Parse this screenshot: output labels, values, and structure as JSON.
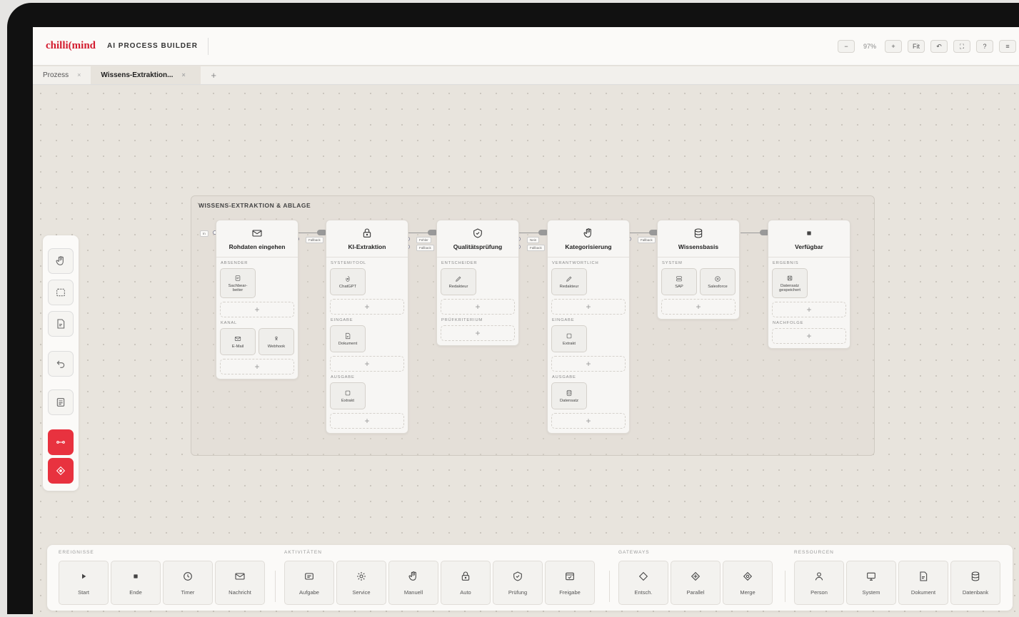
{
  "app": {
    "logo": "chilli(mind",
    "title": "AI PROCESS BUILDER"
  },
  "toolbar": {
    "zoom_out": "−",
    "zoom_level": "97%",
    "zoom_in": "+",
    "fit": "Fit",
    "undo": "↶",
    "fullscreen": "⛶",
    "help": "?",
    "menu": "≡"
  },
  "tabs": [
    {
      "label": "Prozess",
      "close": "×"
    },
    {
      "label": "Wissens-Extraktion...",
      "close": "×"
    }
  ],
  "tab_add": "+",
  "group": {
    "title": "WISSENS-EXTRAKTION & ABLAGE"
  },
  "nodes": [
    {
      "title": "Rohdaten eingehen",
      "icon": "mail-icon",
      "sections": [
        {
          "label": "ABSENDER",
          "chips": [
            {
              "label": "Sachbear-\nbeiter",
              "icon": "form-icon"
            }
          ]
        },
        {
          "label": "KANAL",
          "chips": [
            {
              "label": "E-Mail",
              "icon": "mail-icon"
            },
            {
              "label": "Webhook",
              "icon": "webhook-icon"
            }
          ]
        }
      ]
    },
    {
      "title": "KI-Extraktion",
      "icon": "robot-lock-icon",
      "sections": [
        {
          "label": "SYSTEM/TOOL",
          "chips": [
            {
              "label": "ChatGPT",
              "icon": "chatgpt-icon"
            }
          ]
        },
        {
          "label": "EINGABE",
          "chips": [
            {
              "label": "Dokument",
              "icon": "document-icon"
            }
          ]
        },
        {
          "label": "AUSGABE",
          "chips": [
            {
              "label": "Extrakt",
              "icon": "square-icon"
            }
          ]
        }
      ]
    },
    {
      "title": "Qualitätsprüfung",
      "icon": "shield-check-icon",
      "sections": [
        {
          "label": "ENTSCHEIDER",
          "chips": [
            {
              "label": "Redakteur",
              "icon": "pen-icon"
            }
          ]
        },
        {
          "label": "PRÜFKRITERIUM",
          "chips": []
        }
      ]
    },
    {
      "title": "Kategorisierung",
      "icon": "hand-icon",
      "sections": [
        {
          "label": "VERANTWORTLICH",
          "chips": [
            {
              "label": "Redakteur",
              "icon": "pen-icon"
            }
          ]
        },
        {
          "label": "EINGABE",
          "chips": [
            {
              "label": "Extrakt",
              "icon": "square-icon"
            }
          ]
        },
        {
          "label": "AUSGABE",
          "chips": [
            {
              "label": "Datensatz",
              "icon": "database-icon"
            }
          ]
        }
      ]
    },
    {
      "title": "Wissensbasis",
      "icon": "database-icon",
      "sections": [
        {
          "label": "SYSTEM",
          "chips": [
            {
              "label": "SAP",
              "icon": "server-icon"
            },
            {
              "label": "Salesforce",
              "icon": "plus-circle-icon"
            }
          ]
        }
      ]
    },
    {
      "title": "Verfügbar",
      "icon": "stop-icon",
      "sections": [
        {
          "label": "ERGEBNIS",
          "chips": [
            {
              "label": "Datensatz\ngespeichert",
              "icon": "save-icon"
            }
          ]
        },
        {
          "label": "NACHFOLGE",
          "chips": []
        }
      ]
    }
  ],
  "connectors": {
    "in": "In",
    "fallback": "Fallback",
    "fehler": "Fehler",
    "nein": "Nein"
  },
  "palette": [
    {
      "label": "EREIGNISSE",
      "items": [
        {
          "label": "Start",
          "icon": "play-icon"
        },
        {
          "label": "Ende",
          "icon": "stop-icon"
        },
        {
          "label": "Timer",
          "icon": "clock-icon"
        },
        {
          "label": "Nachricht",
          "icon": "mail-icon"
        }
      ]
    },
    {
      "label": "AKTIVITÄTEN",
      "items": [
        {
          "label": "Aufgabe",
          "icon": "task-icon"
        },
        {
          "label": "Service",
          "icon": "gear-icon"
        },
        {
          "label": "Manuell",
          "icon": "hand-icon"
        },
        {
          "label": "Auto",
          "icon": "robot-lock-icon"
        },
        {
          "label": "Prüfung",
          "icon": "shield-check-icon"
        },
        {
          "label": "Freigabe",
          "icon": "approve-icon"
        }
      ]
    },
    {
      "label": "GATEWAYS",
      "items": [
        {
          "label": "Entsch.",
          "icon": "diamond-icon"
        },
        {
          "label": "Parallel",
          "icon": "diamond-plus-icon"
        },
        {
          "label": "Merge",
          "icon": "diamond-circle-icon"
        }
      ]
    },
    {
      "label": "RESSOURCEN",
      "items": [
        {
          "label": "Person",
          "icon": "person-icon"
        },
        {
          "label": "System",
          "icon": "monitor-icon"
        },
        {
          "label": "Dokument",
          "icon": "document-icon"
        },
        {
          "label": "Datenbank",
          "icon": "database-icon"
        }
      ]
    }
  ]
}
